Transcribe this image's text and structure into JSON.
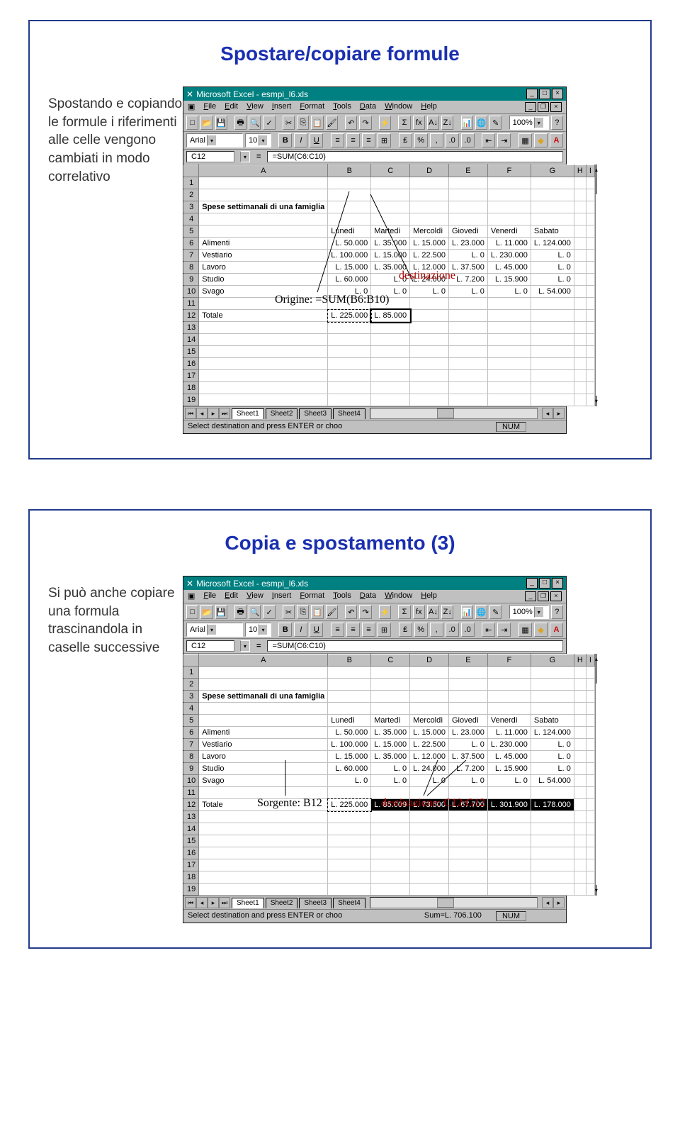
{
  "slide1": {
    "title": "Spostare/copiare formule",
    "body": "Spostando e copiando le formule i riferimenti alle celle vengono cambiati in modo correlativo",
    "annot_origin": "Origine: =SUM(B6:B10)",
    "annot_dest": "destinazione"
  },
  "slide2": {
    "title": "Copia e spostamento (3)",
    "body": "Si può anche copiare una formula trascinandola in caselle successive",
    "annot_src": "Sorgente: B12",
    "annot_dest": "destinazione: C12:G12"
  },
  "excel": {
    "app_title": "Microsoft Excel - esmpi_l6.xls",
    "menus": [
      "File",
      "Edit",
      "View",
      "Insert",
      "Format",
      "Tools",
      "Data",
      "Window",
      "Help"
    ],
    "font": "Arial",
    "fontsize": "10",
    "zoom": "100%",
    "cell_ref": "C12",
    "formula": "=SUM(C6:C10)",
    "cols": [
      "A",
      "B",
      "C",
      "D",
      "E",
      "F",
      "G",
      "H",
      "I"
    ],
    "row_title": "Spese settimanali di una famiglia",
    "headers_row": [
      "",
      "Lunedì",
      "Martedì",
      "Mercoldì",
      "Giovedì",
      "Venerdì",
      "Sabato"
    ],
    "rows": [
      [
        "Alimenti",
        "L. 50.000",
        "L. 35.000",
        "L. 15.000",
        "L. 23.000",
        "L. 11.000",
        "L. 124.000"
      ],
      [
        "Vestiario",
        "L. 100.000",
        "L. 15.000",
        "L. 22.500",
        "L. 0",
        "L. 230.000",
        "L. 0"
      ],
      [
        "Lavoro",
        "L. 15.000",
        "L. 35.000",
        "L. 12.000",
        "L. 37.500",
        "L. 45.000",
        "L. 0"
      ],
      [
        "Studio",
        "L. 60.000",
        "L. 0",
        "L. 24.000",
        "L. 7.200",
        "L. 15.900",
        "L. 0"
      ],
      [
        "Svago",
        "L. 0",
        "L. 0",
        "L. 0",
        "L. 0",
        "L. 0",
        "L. 54.000"
      ]
    ],
    "total_label": "Totale",
    "slide1_totals": [
      "L. 225.000",
      "L. 85.000"
    ],
    "slide2_totals": [
      "L. 225.000",
      "L. 85.009",
      "L. 73.500",
      "L. 67.700",
      "L. 301.900",
      "L. 178.000"
    ],
    "sheet_tabs": [
      "Sheet1",
      "Sheet2",
      "Sheet3",
      "Sheet4"
    ],
    "status1": "Select destination and press ENTER or choo",
    "status2_left": "Select destination and press ENTER or choo",
    "status2_sum": "Sum=L. 706.100",
    "status_num": "NUM"
  }
}
